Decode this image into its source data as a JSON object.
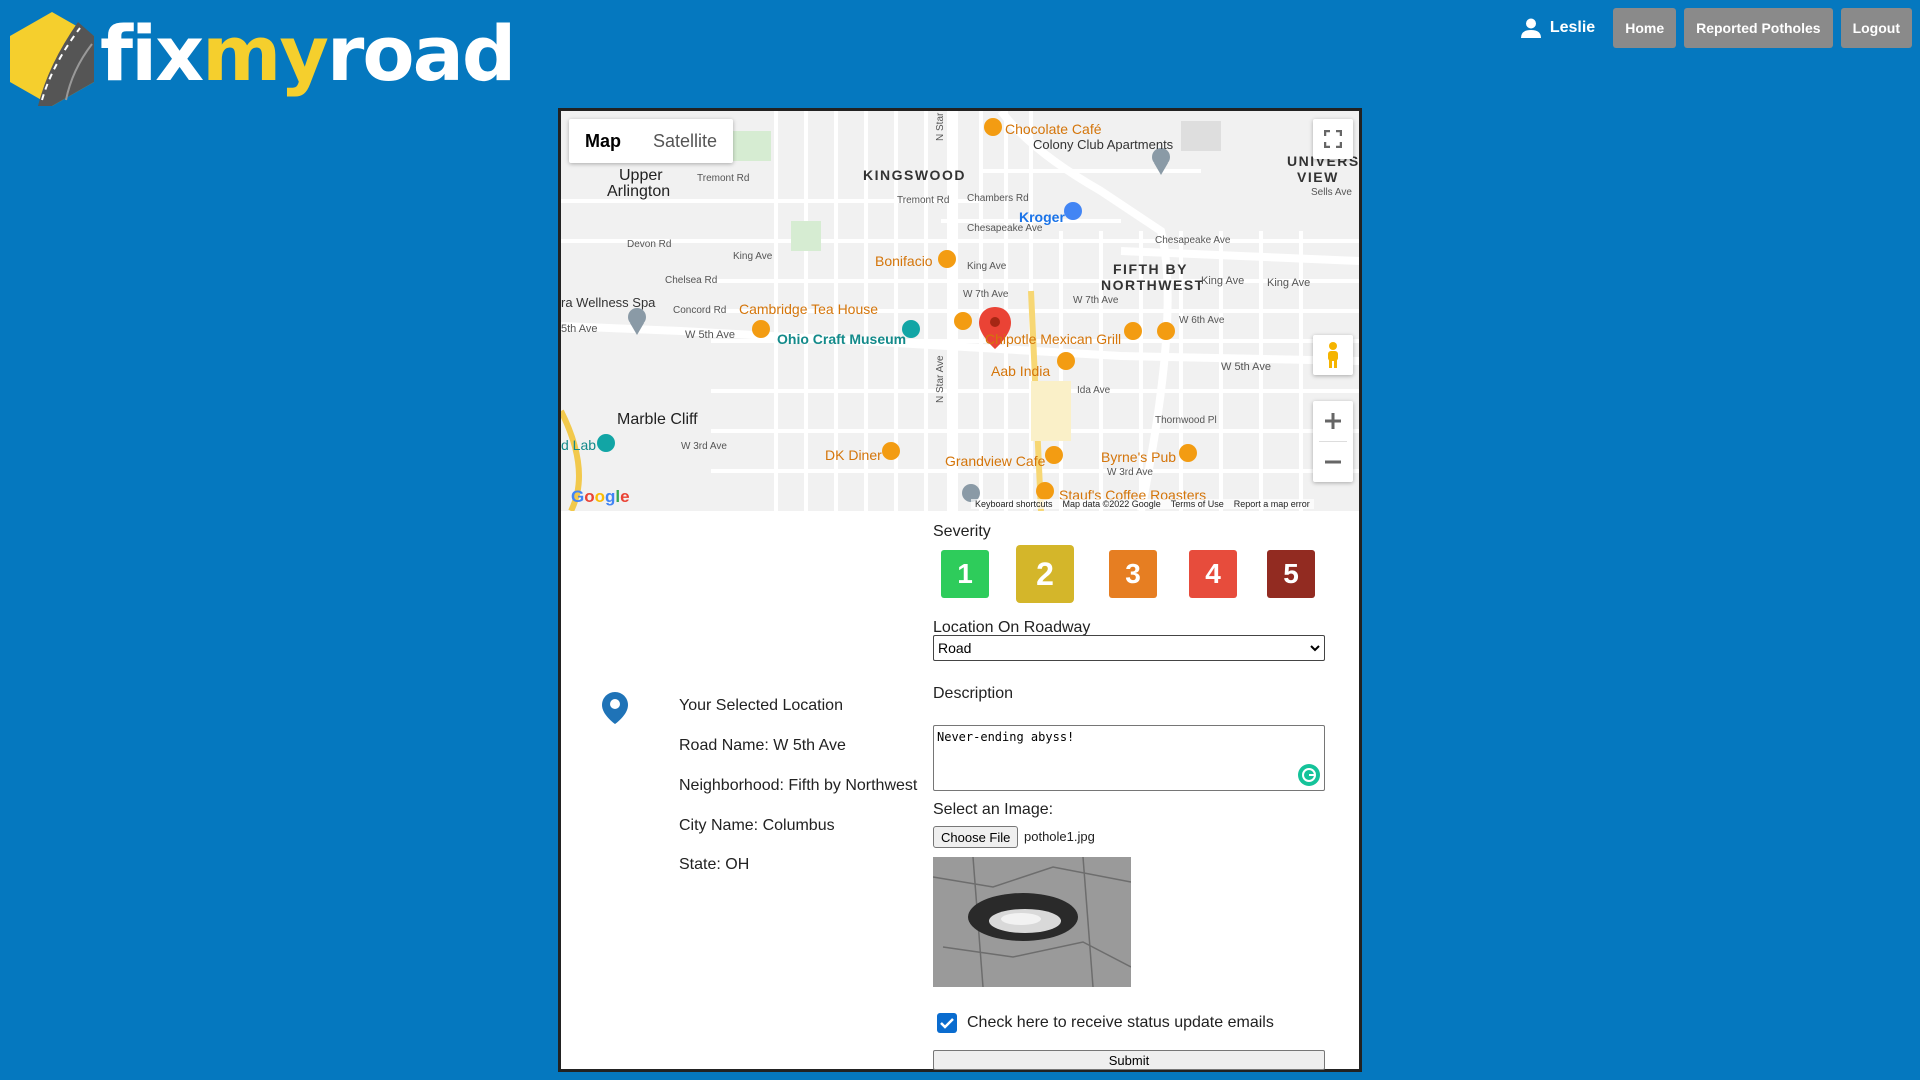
{
  "header": {
    "logo_part1": "fix",
    "logo_part2": "my",
    "logo_part3": "road",
    "user_name": "Leslie",
    "nav": {
      "home": "Home",
      "reported": "Reported Potholes",
      "logout": "Logout"
    }
  },
  "map": {
    "tabs": {
      "map": "Map",
      "satellite": "Satellite"
    },
    "labels": {
      "upper_arlington_1": "Upper",
      "upper_arlington_2": "Arlington",
      "kingswood": "KINGSWOOD",
      "university_view_1": "UNIVERSITY",
      "university_view_2": "VIEW",
      "fifth_by_1": "FIFTH BY",
      "fifth_by_2": "NORTHWEST",
      "marble_cliff": "Marble Cliff",
      "chocolate_cafe": "Chocolate Café",
      "colony_club": "Colony Club Apartments",
      "kroger": "Kroger",
      "bonifacio": "Bonifacio",
      "cambridge_tea": "Cambridge Tea House",
      "ohio_craft": "Ohio Craft Museum",
      "chipotle": "Chipotle Mexican Grill",
      "aab_india": "Aab India",
      "dk_diner": "DK Diner",
      "grandview_cafe": "Grandview Cafe",
      "byrnes_pub": "Byrne's Pub",
      "staufs": "Stauf's Coffee Roasters",
      "wellness_spa": "ra Wellness Spa",
      "lab": "d Lab",
      "w_5th_ave": "W 5th Ave",
      "w_5th_ave_2": "W 5th Ave",
      "fifth_ave_left": "5th Ave",
      "w_3rd_ave": "W 3rd Ave",
      "w_7th_ave": "W 7th Ave",
      "w_7th_ave_2": "W 7th Ave",
      "w_6th_ave": "W 6th Ave",
      "king_ave": "King Ave",
      "king_ave_2": "King Ave",
      "king_ave_3": "King Ave",
      "king_ave_4": "King Ave",
      "chambers_rd": "Chambers Rd",
      "chesapeake_ave": "Chesapeake Ave",
      "chesapeake_ave_2": "Chesapeake Ave",
      "tremont_rd": "Tremont Rd",
      "tremont_rd_2": "Tremont Rd",
      "devon_rd": "Devon Rd",
      "chelsea_rd": "Chelsea Rd",
      "concord_rd": "Concord Rd",
      "ida_ave": "Ida Ave",
      "thornwood_pl": "Thornwood Pl",
      "w_3rd_ave_2": "W 3rd Ave",
      "sells_ave": "Sells Ave",
      "n_star_rd": "N Star Rd",
      "n_star_ave": "N Star Ave",
      "google": "Google"
    },
    "footer": {
      "shortcuts": "Keyboard shortcuts",
      "data": "Map data ©2022 Google",
      "terms": "Terms of Use",
      "report": "Report a map error"
    }
  },
  "location": {
    "title": "Your Selected Location",
    "road": "Road Name: W 5th Ave",
    "neighborhood": "Neighborhood: Fifth by Northwest",
    "city": "City Name: Columbus",
    "state": "State: OH"
  },
  "form": {
    "severity_label": "Severity",
    "severity": [
      {
        "label": "1",
        "color": "#2ecc5b"
      },
      {
        "label": "2",
        "color": "#d4b62a"
      },
      {
        "label": "3",
        "color": "#e67e22"
      },
      {
        "label": "4",
        "color": "#e74c3c"
      },
      {
        "label": "5",
        "color": "#922b21"
      }
    ],
    "selected_severity": "2",
    "location_label": "Location On Roadway",
    "location_value": "Road",
    "description_label": "Description",
    "description_value": "Never-ending abyss!",
    "image_label": "Select an Image:",
    "choose_file": "Choose File",
    "file_name": "pothole1.jpg",
    "checkbox_label": "Check here to receive status update emails",
    "checkbox_checked": true,
    "submit": "Submit"
  }
}
